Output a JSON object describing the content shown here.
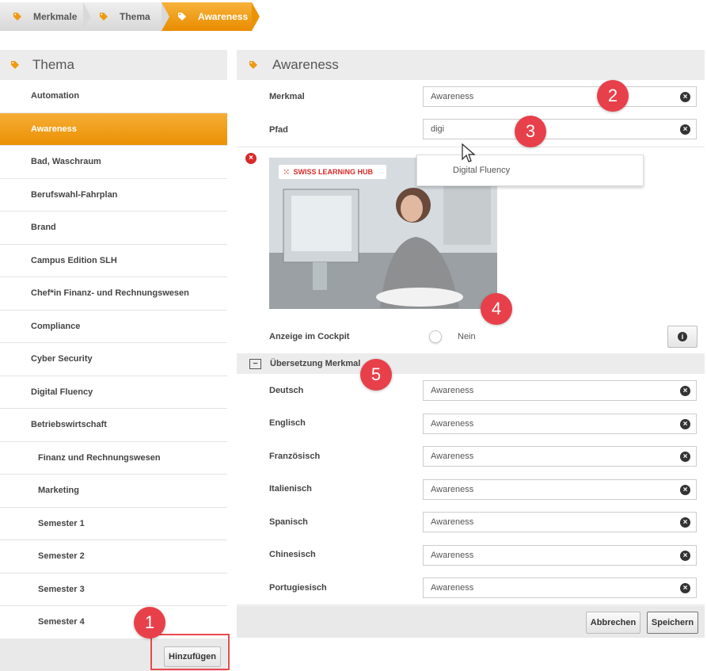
{
  "breadcrumbs": [
    "Merkmale",
    "Thema",
    "Awareness"
  ],
  "left": {
    "title": "Thema",
    "items": [
      {
        "label": "Automation"
      },
      {
        "label": "Awareness"
      },
      {
        "label": "Bad, Waschraum"
      },
      {
        "label": "Berufswahl-Fahrplan"
      },
      {
        "label": "Brand"
      },
      {
        "label": "Campus Edition SLH"
      },
      {
        "label": "Chef*in Finanz- und Rechnungswesen"
      },
      {
        "label": "Compliance"
      },
      {
        "label": "Cyber Security"
      },
      {
        "label": "Digital Fluency"
      },
      {
        "label": "Betriebswirtschaft"
      },
      {
        "label": "Finanz und Rechnungswesen"
      },
      {
        "label": "Marketing"
      },
      {
        "label": "Semester 1"
      },
      {
        "label": "Semester 2"
      },
      {
        "label": "Semester 3"
      },
      {
        "label": "Semester 4"
      }
    ],
    "add_label": "Hinzufügen"
  },
  "right": {
    "title": "Awareness",
    "merkmal_label": "Merkmal",
    "merkmal_value": "Awareness",
    "pfad_label": "Pfad",
    "pfad_value": "digi",
    "suggestion": "Digital Fluency",
    "image_logo_text": "SWISS LEARNiNG HUB",
    "cockpit_label": "Anzeige im Cockpit",
    "cockpit_value": "Nein",
    "translations_title": "Übersetzung Merkmal",
    "translations": [
      {
        "lang": "Deutsch",
        "value": "Awareness"
      },
      {
        "lang": "Englisch",
        "value": "Awareness"
      },
      {
        "lang": "Französisch",
        "value": "Awareness"
      },
      {
        "lang": "Italienisch",
        "value": "Awareness"
      },
      {
        "lang": "Spanisch",
        "value": "Awareness"
      },
      {
        "lang": "Chinesisch",
        "value": "Awareness"
      },
      {
        "lang": "Portugiesisch",
        "value": "Awareness"
      }
    ],
    "cancel_label": "Abbrechen",
    "save_label": "Speichern"
  },
  "annotations": [
    "1",
    "2",
    "3",
    "4",
    "5"
  ],
  "colors": {
    "accent": "#ef9a12",
    "badge": "#e8404a",
    "highlight_box": "#e8494f"
  }
}
